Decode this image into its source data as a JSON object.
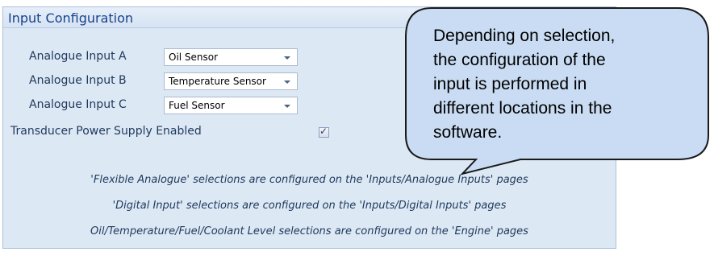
{
  "panel": {
    "title": "Input Configuration"
  },
  "inputs": [
    {
      "label": "Analogue Input A",
      "value": "Oil Sensor"
    },
    {
      "label": "Analogue Input B",
      "value": "Temperature Sensor"
    },
    {
      "label": "Analogue Input C",
      "value": "Fuel Sensor"
    }
  ],
  "transducer": {
    "label": "Transducer Power Supply Enabled",
    "checked": true
  },
  "info_lines": [
    "'Flexible Analogue' selections are configured on the 'Inputs/Analogue Inputs' pages",
    "'Digital Input' selections are configured on the 'Inputs/Digital Inputs' pages",
    "Oil/Temperature/Fuel/Coolant Level selections are configured on the 'Engine' pages"
  ],
  "callout": {
    "lines": [
      "Depending on selection,",
      "the configuration of the",
      "input is performed in",
      "different locations in the",
      "software."
    ]
  },
  "colors": {
    "panel_bg": "#dde8f5",
    "title": "#15428b",
    "callout_fill": "#c9dcf3"
  }
}
